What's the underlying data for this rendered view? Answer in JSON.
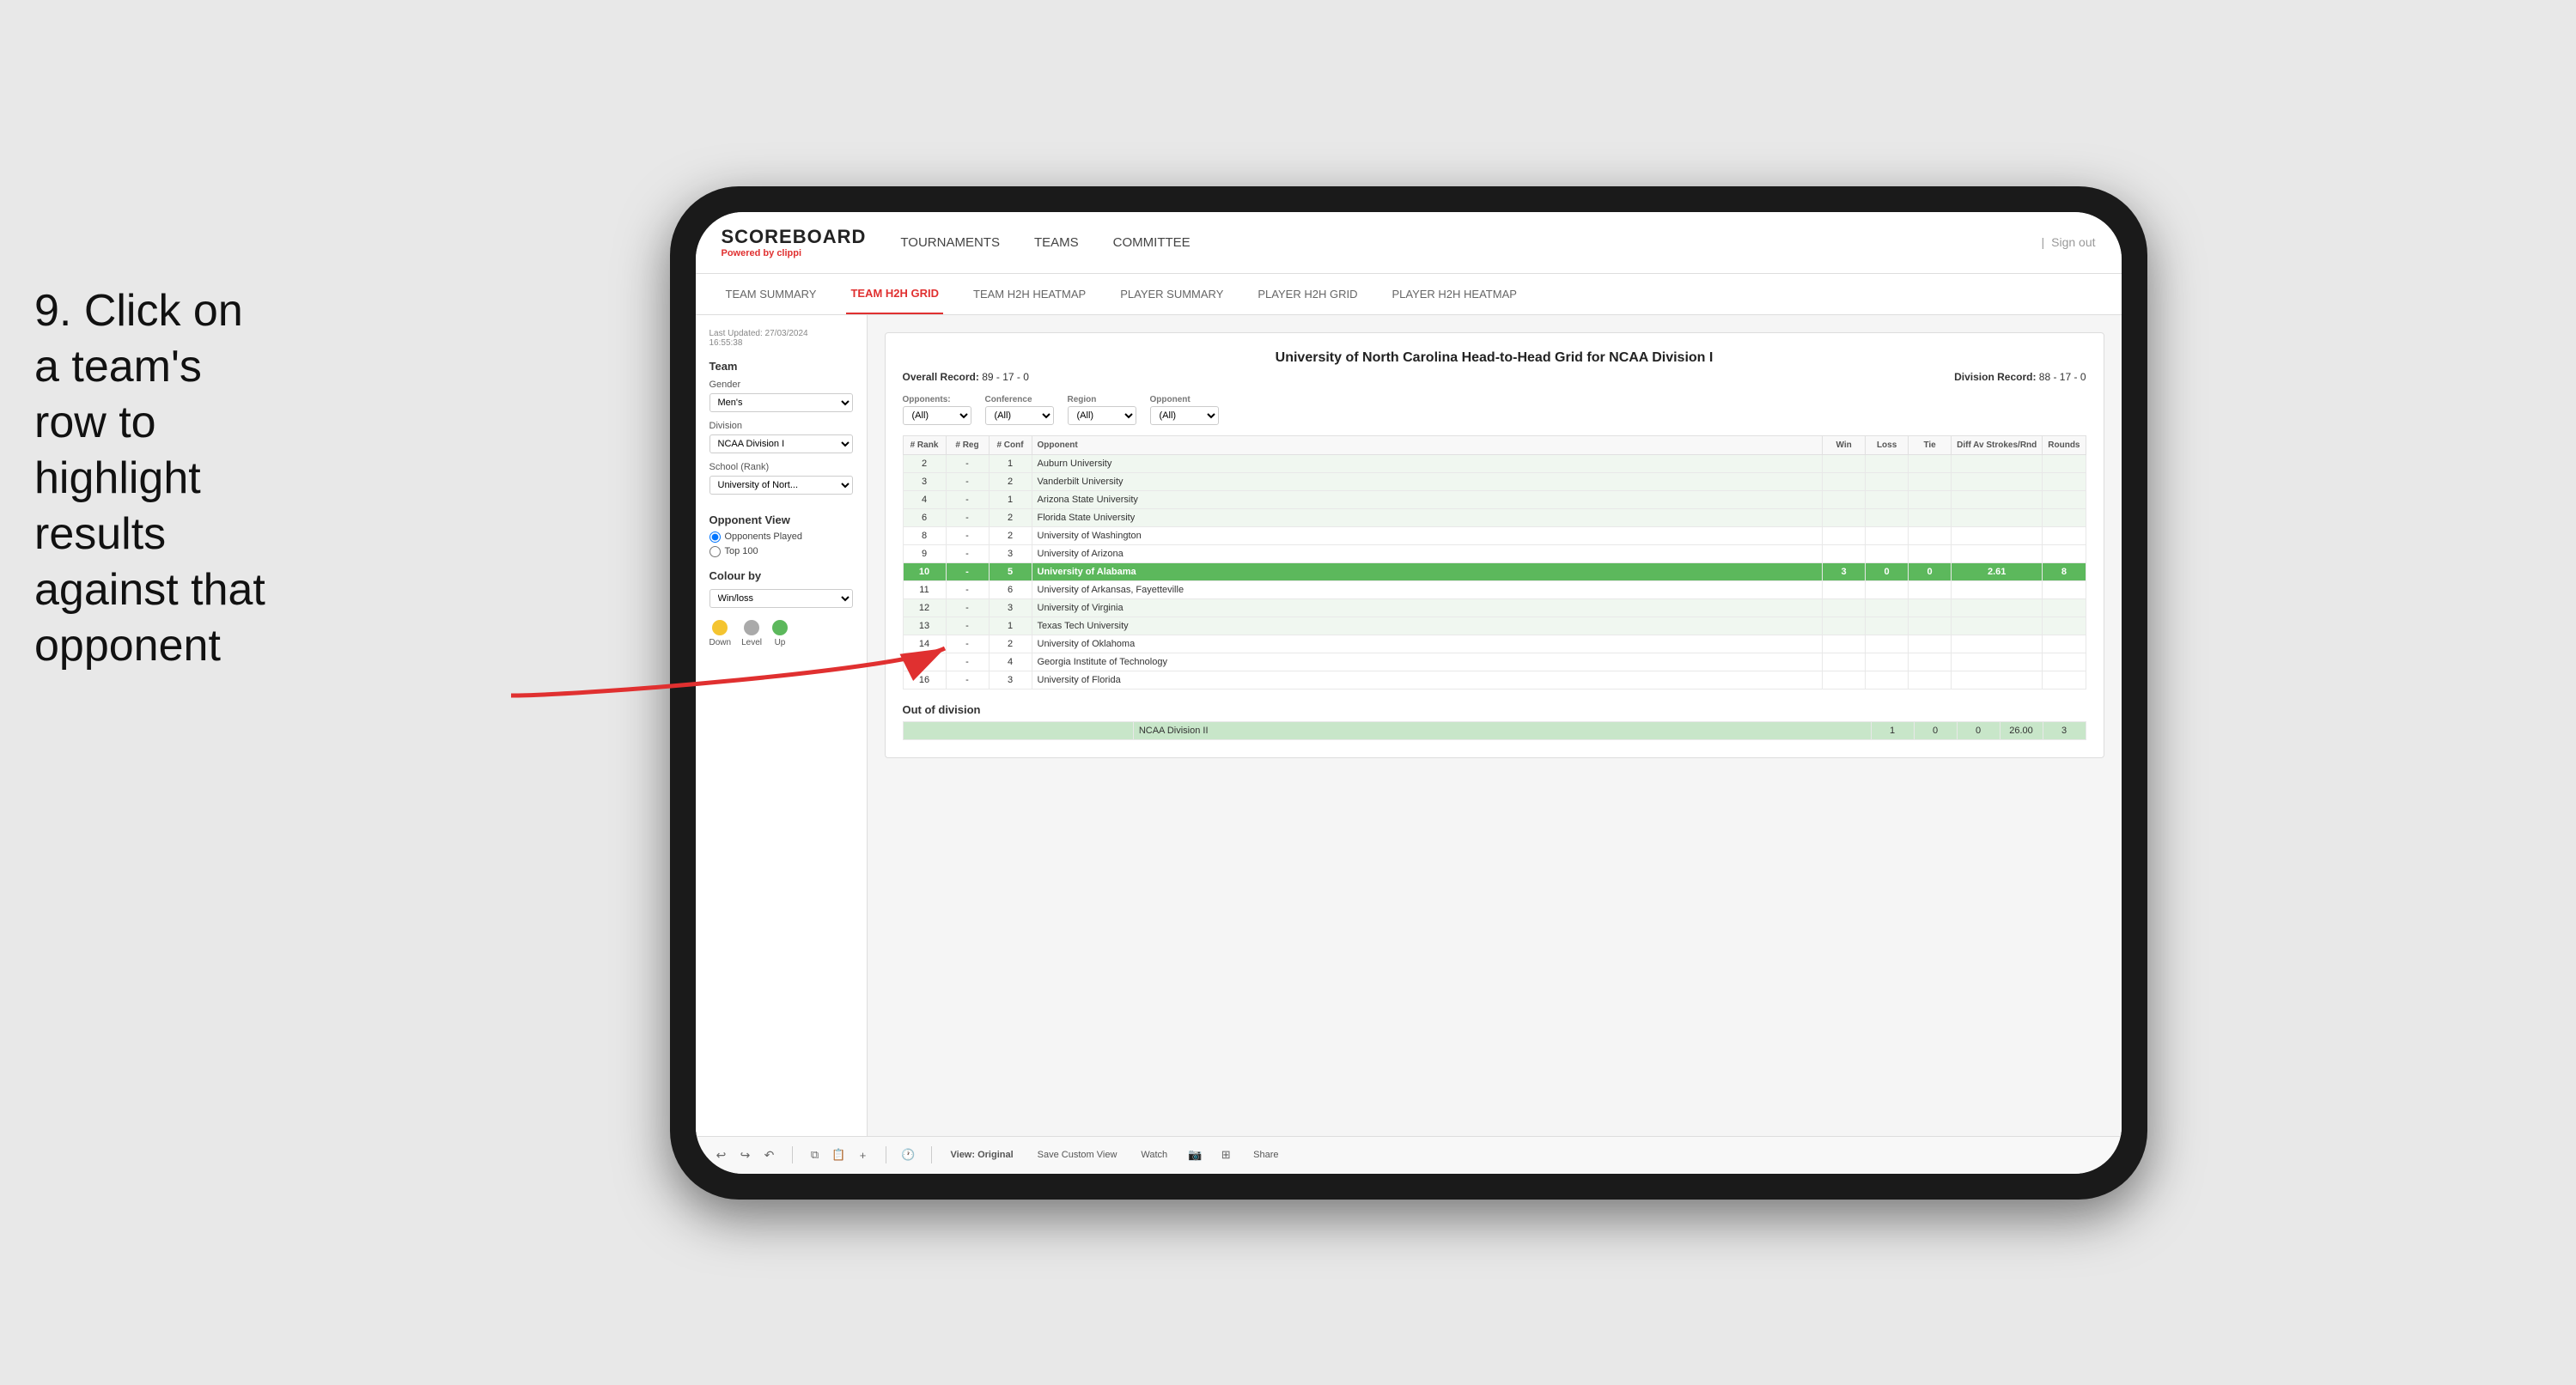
{
  "annotation": {
    "text": "9. Click on a team's row to highlight results against that opponent"
  },
  "nav": {
    "logo": "SCOREBOARD",
    "powered_by": "Powered by",
    "brand": "clippi",
    "items": [
      "TOURNAMENTS",
      "TEAMS",
      "COMMITTEE"
    ],
    "sign_out_separator": "|",
    "sign_out": "Sign out"
  },
  "sub_nav": {
    "items": [
      "TEAM SUMMARY",
      "TEAM H2H GRID",
      "TEAM H2H HEATMAP",
      "PLAYER SUMMARY",
      "PLAYER H2H GRID",
      "PLAYER H2H HEATMAP"
    ],
    "active": "TEAM H2H GRID"
  },
  "left_panel": {
    "last_updated_label": "Last Updated: 27/03/2024",
    "last_updated_time": "16:55:38",
    "team_label": "Team",
    "gender_label": "Gender",
    "gender_value": "Men's",
    "division_label": "Division",
    "division_value": "NCAA Division I",
    "school_label": "School (Rank)",
    "school_value": "University of Nort...",
    "opponent_view_label": "Opponent View",
    "opponents_played": "Opponents Played",
    "top_100": "Top 100",
    "colour_by_label": "Colour by",
    "colour_by_value": "Win/loss",
    "legend": [
      {
        "label": "Down",
        "color": "#f4c430"
      },
      {
        "label": "Level",
        "color": "#aaaaaa"
      },
      {
        "label": "Up",
        "color": "#5cb85c"
      }
    ]
  },
  "grid": {
    "title": "University of North Carolina Head-to-Head Grid for NCAA Division I",
    "overall_record_label": "Overall Record:",
    "overall_record": "89 - 17 - 0",
    "division_record_label": "Division Record:",
    "division_record": "88 - 17 - 0",
    "filters": {
      "opponents_label": "Opponents:",
      "opponents_value": "(All)",
      "conference_label": "Conference",
      "conference_value": "(All)",
      "region_label": "Region",
      "region_value": "(All)",
      "opponent_label": "Opponent",
      "opponent_value": "(All)"
    },
    "columns": [
      "# Rank",
      "# Reg",
      "# Conf",
      "Opponent",
      "Win",
      "Loss",
      "Tie",
      "Diff Av Strokes/Rnd",
      "Rounds"
    ],
    "rows": [
      {
        "rank": "2",
        "reg": "-",
        "conf": "1",
        "opponent": "Auburn University",
        "win": "",
        "loss": "",
        "tie": "",
        "diff": "",
        "rounds": "",
        "highlight": false,
        "style": "light"
      },
      {
        "rank": "3",
        "reg": "-",
        "conf": "2",
        "opponent": "Vanderbilt University",
        "win": "",
        "loss": "",
        "tie": "",
        "diff": "",
        "rounds": "",
        "highlight": false,
        "style": "light"
      },
      {
        "rank": "4",
        "reg": "-",
        "conf": "1",
        "opponent": "Arizona State University",
        "win": "",
        "loss": "",
        "tie": "",
        "diff": "",
        "rounds": "",
        "highlight": false,
        "style": "light"
      },
      {
        "rank": "6",
        "reg": "-",
        "conf": "2",
        "opponent": "Florida State University",
        "win": "",
        "loss": "",
        "tie": "",
        "diff": "",
        "rounds": "",
        "highlight": false,
        "style": "light"
      },
      {
        "rank": "8",
        "reg": "-",
        "conf": "2",
        "opponent": "University of Washington",
        "win": "",
        "loss": "",
        "tie": "",
        "diff": "",
        "rounds": "",
        "highlight": false,
        "style": "none"
      },
      {
        "rank": "9",
        "reg": "-",
        "conf": "3",
        "opponent": "University of Arizona",
        "win": "",
        "loss": "",
        "tie": "",
        "diff": "",
        "rounds": "",
        "highlight": false,
        "style": "none"
      },
      {
        "rank": "10",
        "reg": "-",
        "conf": "5",
        "opponent": "University of Alabama",
        "win": "3",
        "loss": "0",
        "tie": "0",
        "diff": "2.61",
        "rounds": "8",
        "highlight": true,
        "style": "green"
      },
      {
        "rank": "11",
        "reg": "-",
        "conf": "6",
        "opponent": "University of Arkansas, Fayetteville",
        "win": "",
        "loss": "",
        "tie": "",
        "diff": "",
        "rounds": "",
        "highlight": false,
        "style": "none"
      },
      {
        "rank": "12",
        "reg": "-",
        "conf": "3",
        "opponent": "University of Virginia",
        "win": "",
        "loss": "",
        "tie": "",
        "diff": "",
        "rounds": "",
        "highlight": false,
        "style": "light"
      },
      {
        "rank": "13",
        "reg": "-",
        "conf": "1",
        "opponent": "Texas Tech University",
        "win": "",
        "loss": "",
        "tie": "",
        "diff": "",
        "rounds": "",
        "highlight": false,
        "style": "light"
      },
      {
        "rank": "14",
        "reg": "-",
        "conf": "2",
        "opponent": "University of Oklahoma",
        "win": "",
        "loss": "",
        "tie": "",
        "diff": "",
        "rounds": "",
        "highlight": false,
        "style": "none"
      },
      {
        "rank": "15",
        "reg": "-",
        "conf": "4",
        "opponent": "Georgia Institute of Technology",
        "win": "",
        "loss": "",
        "tie": "",
        "diff": "",
        "rounds": "",
        "highlight": false,
        "style": "none"
      },
      {
        "rank": "16",
        "reg": "-",
        "conf": "3",
        "opponent": "University of Florida",
        "win": "",
        "loss": "",
        "tie": "",
        "diff": "",
        "rounds": "",
        "highlight": false,
        "style": "none"
      }
    ],
    "out_of_division_label": "Out of division",
    "out_of_division_row": {
      "label": "NCAA Division II",
      "win": "1",
      "loss": "0",
      "tie": "0",
      "diff": "26.00",
      "rounds": "3"
    }
  },
  "toolbar": {
    "view_original": "View: Original",
    "save_custom_view": "Save Custom View",
    "watch": "Watch",
    "share": "Share"
  }
}
